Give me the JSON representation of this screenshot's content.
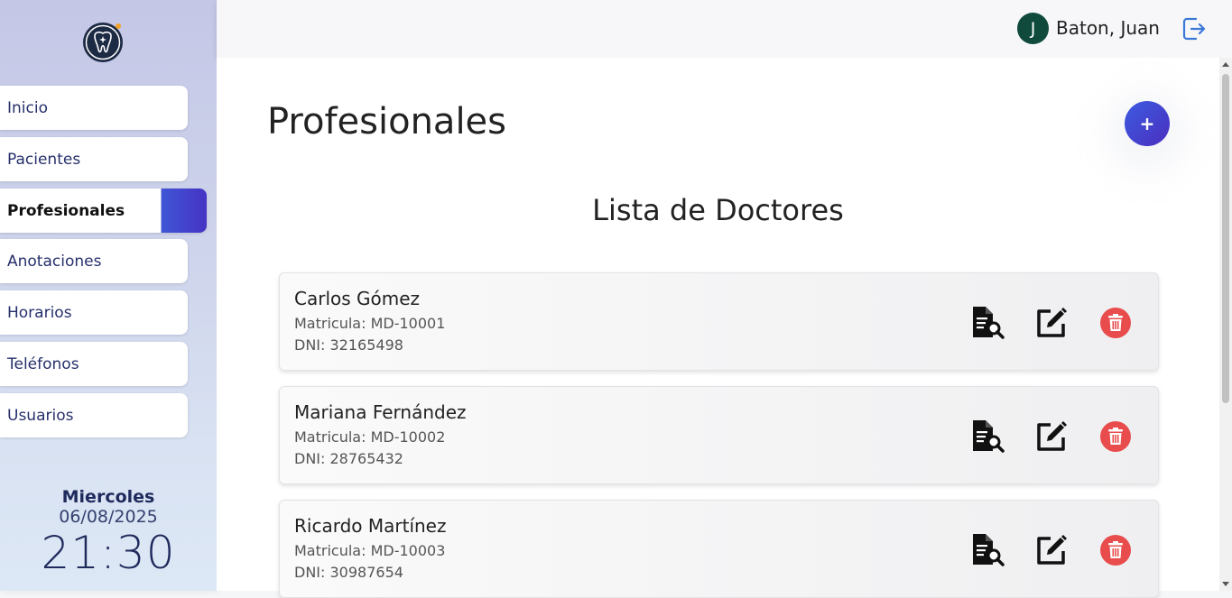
{
  "sidebar": {
    "items": [
      {
        "label": "Inicio"
      },
      {
        "label": "Pacientes"
      },
      {
        "label": "Profesionales"
      },
      {
        "label": "Anotaciones"
      },
      {
        "label": "Horarios"
      },
      {
        "label": "Teléfonos"
      },
      {
        "label": "Usuarios"
      }
    ],
    "active_item": "Profesionales",
    "day": "Miercoles",
    "date": "06/08/2025",
    "time": "21:30"
  },
  "header": {
    "avatar_initial": "J",
    "user_name": "Baton, Juan",
    "logout_icon": "logout-icon"
  },
  "main": {
    "title": "Profesionales",
    "add_button_label": "+",
    "list_title": "Lista de Doctores",
    "doctors": [
      {
        "name": "Carlos Gómez",
        "matricula": "Matricula: MD-10001",
        "dni": "DNI: 32165498"
      },
      {
        "name": "Mariana Fernández",
        "matricula": "Matricula: MD-10002",
        "dni": "DNI: 28765432"
      },
      {
        "name": "Ricardo Martínez",
        "matricula": "Matricula: MD-10003",
        "dni": "DNI: 30987654"
      }
    ]
  },
  "colors": {
    "accent": "#4633c4",
    "avatar": "#0f4a3c",
    "delete": "#e84c4c"
  }
}
